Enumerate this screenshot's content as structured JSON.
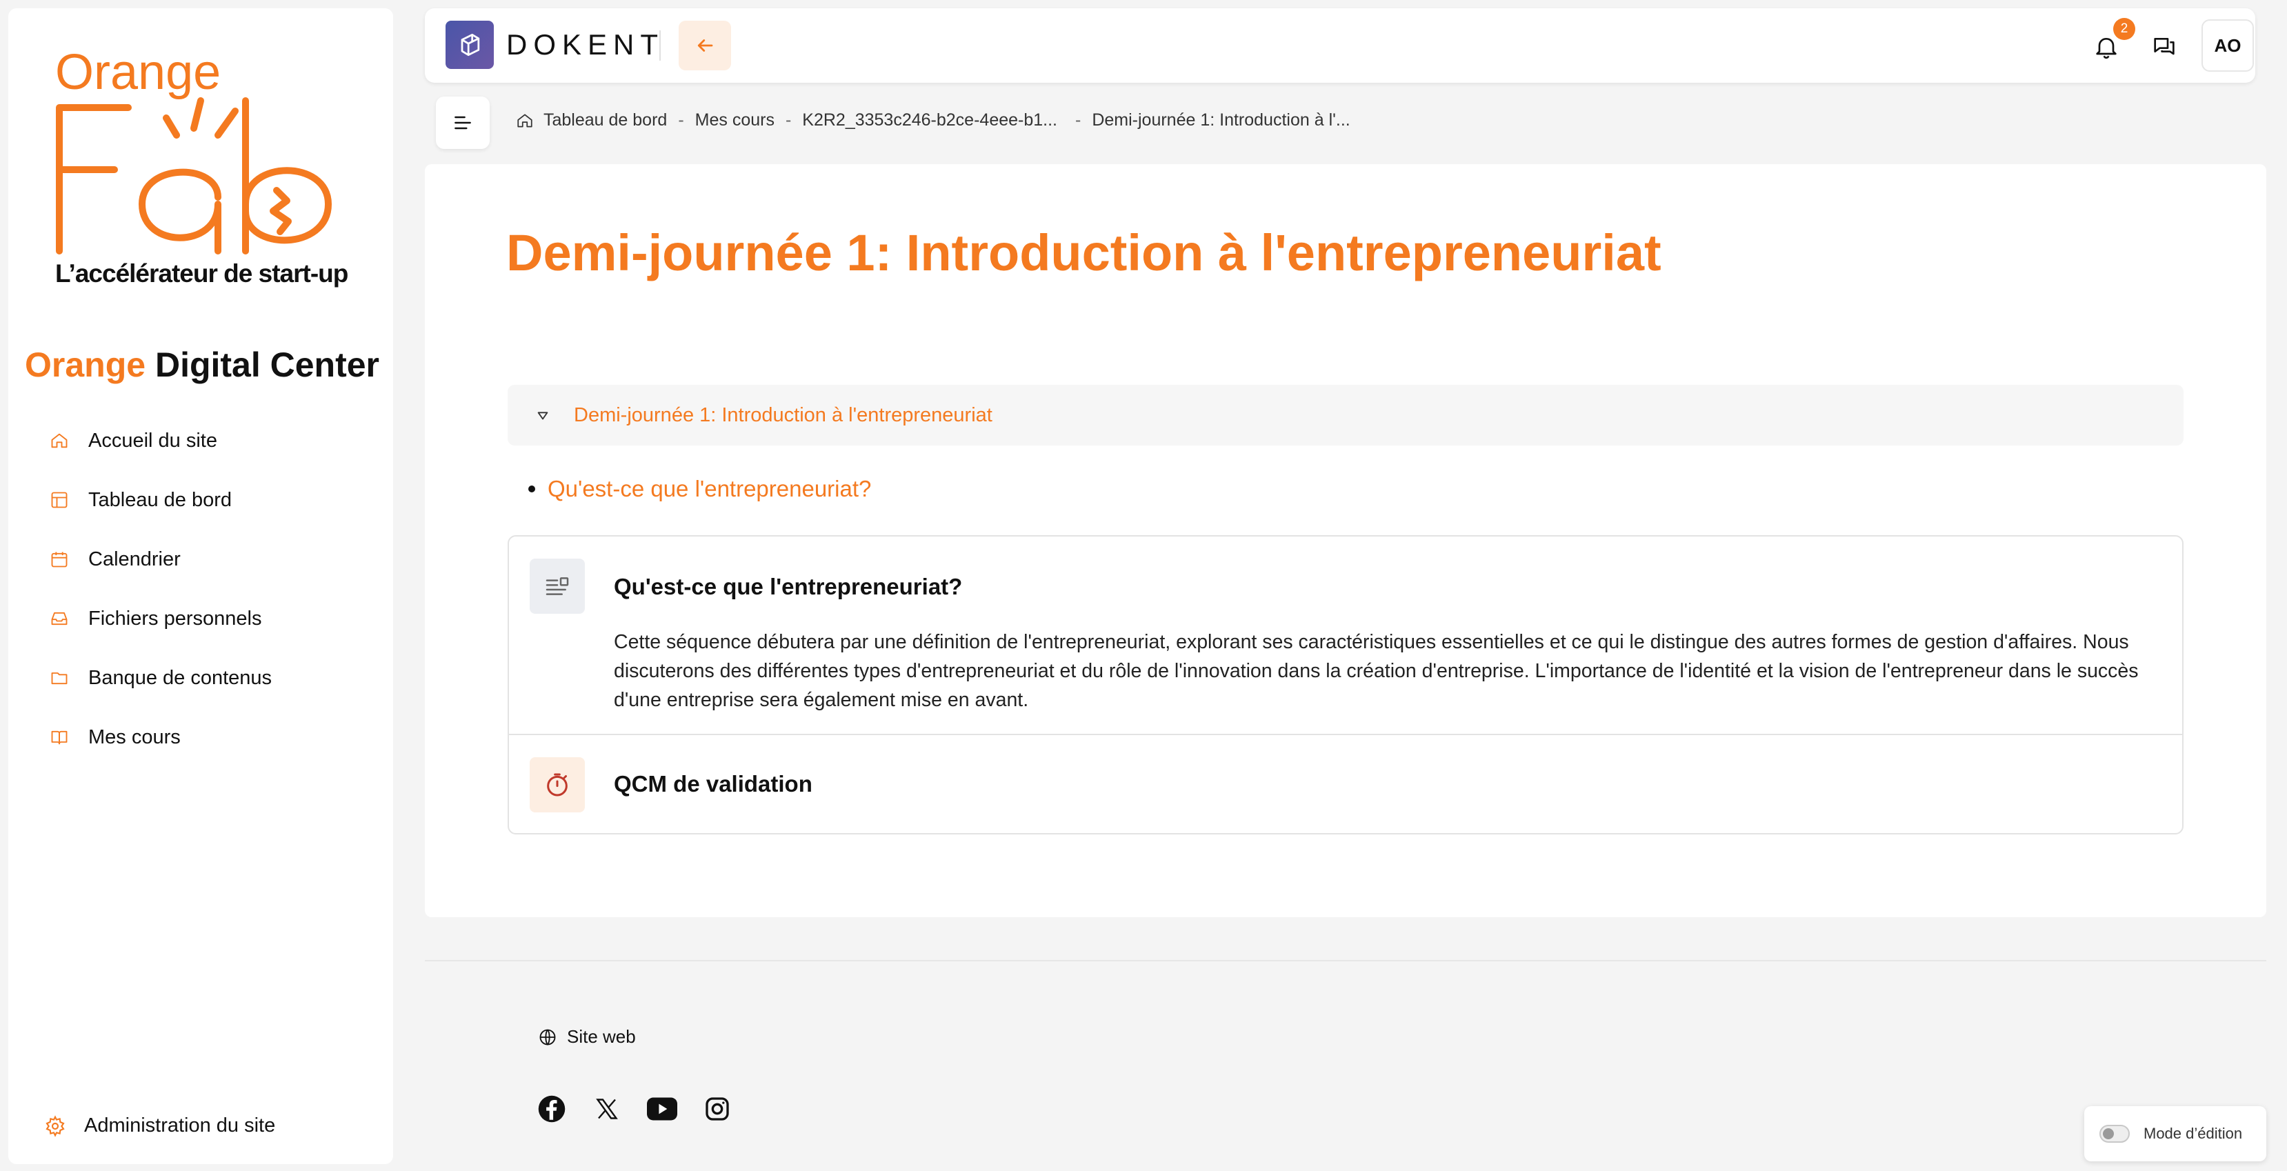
{
  "sidebar": {
    "logo": {
      "orange_word": "Orange",
      "fab_word": "Fab",
      "tagline": "L’accélérateur de start-up"
    },
    "odc_title": {
      "accent": "Orange",
      "rest": " Digital Center"
    },
    "items": [
      {
        "label": "Accueil du site",
        "icon": "home-icon"
      },
      {
        "label": "Tableau de bord",
        "icon": "dashboard-icon"
      },
      {
        "label": "Calendrier",
        "icon": "calendar-icon"
      },
      {
        "label": "Fichiers personnels",
        "icon": "inbox-icon"
      },
      {
        "label": "Banque de contenus",
        "icon": "folder-icon"
      },
      {
        "label": "Mes cours",
        "icon": "book-icon"
      }
    ],
    "admin_label": "Administration du site"
  },
  "header": {
    "brand_name": "DOKENT",
    "notifications_count": "2",
    "avatar_initials": "AO"
  },
  "breadcrumb": {
    "home": "Tableau de bord",
    "courses": "Mes cours",
    "course": "K2R2_3353c246-b2ce-4eee-b1...",
    "section": "Demi-journée 1: Introduction à l'..."
  },
  "main": {
    "title": "Demi-journée 1: Introduction à l'entrepreneuriat",
    "section_label": "Demi-journée 1: Introduction à l'entrepreneuriat",
    "bullet_link": "Qu'est-ce que l'entrepreneuriat?",
    "activities": [
      {
        "title": "Qu'est-ce que l'entrepreneuriat?",
        "description": "Cette séquence débutera par une définition de l'entrepreneuriat, explorant ses caractéristiques essentielles et ce qui le distingue des autres formes de gestion d'affaires. Nous discuterons des différentes types d'entrepreneuriat et du rôle de l'innovation dans la création d'entreprise. L'importance de l'identité et la vision de l'entrepreneur dans le succès d'une entreprise sera également mise en avant."
      },
      {
        "title": "QCM de validation"
      }
    ]
  },
  "footer": {
    "website_label": "Site web",
    "socials": [
      "facebook-icon",
      "x-icon",
      "youtube-icon",
      "instagram-icon"
    ]
  },
  "edit_mode_label": "Mode d’édition",
  "colors": {
    "accent": "#f47a20",
    "brand": "#4a56a8"
  }
}
